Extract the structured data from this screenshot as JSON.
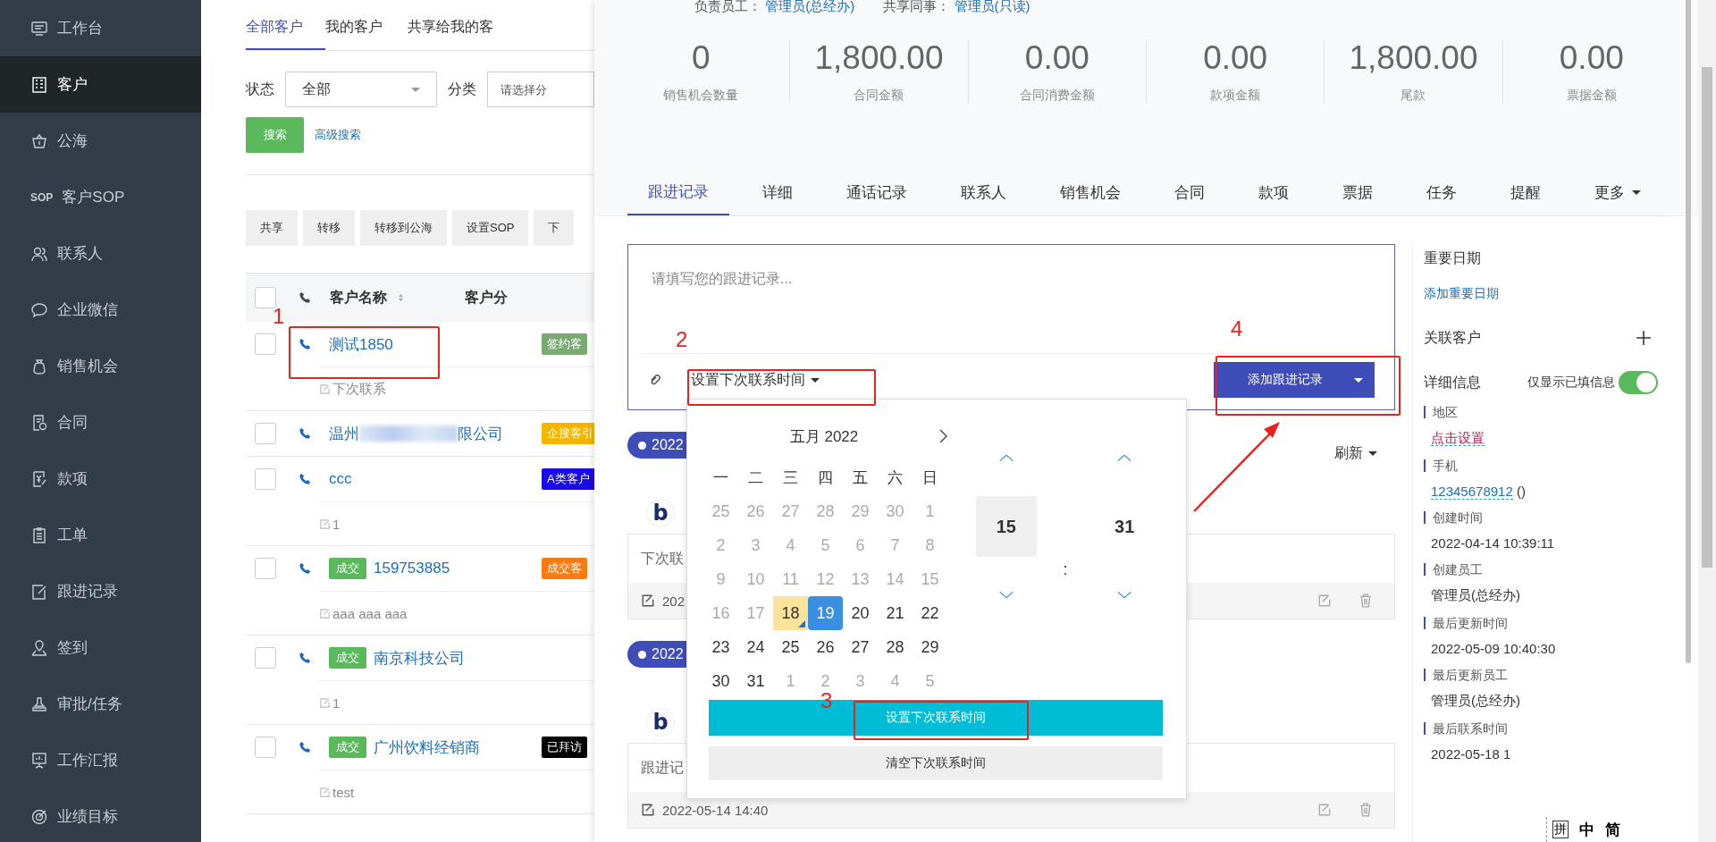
{
  "sidebar": {
    "items": [
      {
        "label": "工作台",
        "selected": false
      },
      {
        "label": "客户",
        "selected": true
      },
      {
        "label": "公海",
        "selected": false
      },
      {
        "label": "客户SOP",
        "icon_text": "SOP",
        "selected": false
      },
      {
        "label": "联系人",
        "selected": false
      },
      {
        "label": "企业微信",
        "selected": false
      },
      {
        "label": "销售机会",
        "selected": false
      },
      {
        "label": "合同",
        "selected": false
      },
      {
        "label": "款项",
        "selected": false
      },
      {
        "label": "工单",
        "selected": false
      },
      {
        "label": "跟进记录",
        "selected": false
      },
      {
        "label": "签到",
        "selected": false
      },
      {
        "label": "审批/任务",
        "selected": false
      },
      {
        "label": "工作汇报",
        "selected": false
      },
      {
        "label": "业绩目标",
        "selected": false
      }
    ]
  },
  "customer_list": {
    "tabs": [
      {
        "label": "全部客户",
        "selected": true
      },
      {
        "label": "我的客户",
        "selected": false
      },
      {
        "label": "共享给我的客",
        "selected": false
      }
    ],
    "filters": {
      "status_label": "状态",
      "status_value": "全部",
      "category_label": "分类",
      "category_placeholder": "请选择分"
    },
    "search_button": "搜索",
    "advanced_search": "高级搜索",
    "actions": [
      "共享",
      "转移",
      "转移到公海",
      "设置SOP",
      "下"
    ],
    "columns": {
      "name": "客户名称",
      "category": "客户分"
    },
    "select_all_checked": false,
    "rows": [
      {
        "checked": false,
        "name": "测试1850",
        "tag": "签约客",
        "color": "#7aa974",
        "note": "下次联系"
      },
      {
        "checked": false,
        "name": "温州",
        "redacted": true,
        "name_tail": "限公司",
        "tag": "企搜客引",
        "color": "#f4b400"
      },
      {
        "checked": false,
        "name": "ccc",
        "tag": "A类客户",
        "color": "#1a0ae6",
        "note": "1"
      },
      {
        "checked": false,
        "badge": "成交",
        "name": "159753885",
        "tag": "成交客",
        "color": "#ff7b0f",
        "note": "aaa aaa aaa"
      },
      {
        "checked": false,
        "badge": "成交",
        "name": "南京科技公司",
        "note": "1"
      },
      {
        "checked": false,
        "badge": "成交",
        "name": "广州饮料经销商",
        "tag": "已拜访",
        "color": "#000000",
        "note": "test"
      }
    ]
  },
  "detail": {
    "owner_line": {
      "owner_label": "负责员工：",
      "owner": "管理员(总经办)",
      "shared_label": "共享同事：",
      "shared": "管理员(只读)"
    },
    "stats": [
      {
        "value": "0",
        "label": "销售机会数量"
      },
      {
        "value": "1,800.00",
        "label": "合同金额"
      },
      {
        "value": "0.00",
        "label": "合同消费金额"
      },
      {
        "value": "0.00",
        "label": "款项金额"
      },
      {
        "value": "1,800.00",
        "label": "尾款"
      },
      {
        "value": "0.00",
        "label": "票据金额"
      }
    ],
    "tabs": [
      {
        "label": "跟进记录",
        "selected": true
      },
      {
        "label": "详细",
        "selected": false
      },
      {
        "label": "通话记录",
        "selected": false
      },
      {
        "label": "联系人",
        "selected": false
      },
      {
        "label": "销售机会",
        "selected": false
      },
      {
        "label": "合同",
        "selected": false
      },
      {
        "label": "款项",
        "selected": false
      },
      {
        "label": "票据",
        "selected": false
      },
      {
        "label": "任务",
        "selected": false
      },
      {
        "label": "提醒",
        "selected": false
      },
      {
        "label": "更多",
        "dropdown": true,
        "selected": false
      }
    ],
    "editor": {
      "placeholder": "请填写您的跟进记录...",
      "next_contact_button": "设置下次联系时间",
      "add_button": "添加跟进记录"
    },
    "refresh": "刷新",
    "timeline": [
      {
        "date": "2022",
        "logo": "b",
        "text": "下次联",
        "footer": "202"
      },
      {
        "date": "2022",
        "logo": "b",
        "text": "跟进记",
        "footer": "2022-05-14 14:40"
      }
    ],
    "datepicker": {
      "month": "五月 2022",
      "weekdays": [
        "一",
        "二",
        "三",
        "四",
        "五",
        "六",
        "日"
      ],
      "weeks": [
        [
          {
            "day": "25",
            "muted": true,
            "selected": false,
            "today": false
          },
          {
            "day": "26",
            "muted": true,
            "selected": false,
            "today": false
          },
          {
            "day": "27",
            "muted": true,
            "selected": false,
            "today": false
          },
          {
            "day": "28",
            "muted": true,
            "selected": false,
            "today": false
          },
          {
            "day": "29",
            "muted": true,
            "selected": false,
            "today": false
          },
          {
            "day": "30",
            "muted": true,
            "selected": false,
            "today": false
          },
          {
            "day": "1",
            "muted": true,
            "selected": false,
            "today": false
          }
        ],
        [
          {
            "day": "2",
            "muted": true,
            "selected": false,
            "today": false
          },
          {
            "day": "3",
            "muted": true,
            "selected": false,
            "today": false
          },
          {
            "day": "4",
            "muted": true,
            "selected": false,
            "today": false
          },
          {
            "day": "5",
            "muted": true,
            "selected": false,
            "today": false
          },
          {
            "day": "6",
            "muted": true,
            "selected": false,
            "today": false
          },
          {
            "day": "7",
            "muted": true,
            "selected": false,
            "today": false
          },
          {
            "day": "8",
            "muted": true,
            "selected": false,
            "today": false
          }
        ],
        [
          {
            "day": "9",
            "muted": true,
            "selected": false,
            "today": false
          },
          {
            "day": "10",
            "muted": true,
            "selected": false,
            "today": false
          },
          {
            "day": "11",
            "muted": true,
            "selected": false,
            "today": false
          },
          {
            "day": "12",
            "muted": true,
            "selected": false,
            "today": false
          },
          {
            "day": "13",
            "muted": true,
            "selected": false,
            "today": false
          },
          {
            "day": "14",
            "muted": true,
            "selected": false,
            "today": false
          },
          {
            "day": "15",
            "muted": true,
            "selected": false,
            "today": false
          }
        ],
        [
          {
            "day": "16",
            "muted": true,
            "selected": false,
            "today": false
          },
          {
            "day": "17",
            "muted": true,
            "selected": false,
            "today": false
          },
          {
            "day": "18",
            "muted": false,
            "selected": false,
            "today": true
          },
          {
            "day": "19",
            "muted": false,
            "selected": true,
            "today": false
          },
          {
            "day": "20",
            "muted": false,
            "selected": false,
            "today": false
          },
          {
            "day": "21",
            "muted": false,
            "selected": false,
            "today": false
          },
          {
            "day": "22",
            "muted": false,
            "selected": false,
            "today": false
          }
        ],
        [
          {
            "day": "23",
            "muted": false,
            "selected": false,
            "today": false
          },
          {
            "day": "24",
            "muted": false,
            "selected": false,
            "today": false
          },
          {
            "day": "25",
            "muted": false,
            "selected": false,
            "today": false
          },
          {
            "day": "26",
            "muted": false,
            "selected": false,
            "today": false
          },
          {
            "day": "27",
            "muted": false,
            "selected": false,
            "today": false
          },
          {
            "day": "28",
            "muted": false,
            "selected": false,
            "today": false
          },
          {
            "day": "29",
            "muted": false,
            "selected": false,
            "today": false
          }
        ],
        [
          {
            "day": "30",
            "muted": false,
            "selected": false,
            "today": false
          },
          {
            "day": "31",
            "muted": false,
            "selected": false,
            "today": false
          },
          {
            "day": "1",
            "muted": true,
            "selected": false,
            "today": false
          },
          {
            "day": "2",
            "muted": true,
            "selected": false,
            "today": false
          },
          {
            "day": "3",
            "muted": true,
            "selected": false,
            "today": false
          },
          {
            "day": "4",
            "muted": true,
            "selected": false,
            "today": false
          },
          {
            "day": "5",
            "muted": true,
            "selected": false,
            "today": false
          }
        ]
      ],
      "hour": "15",
      "separator": ":",
      "minute": "31",
      "set_button": "设置下次联系时间",
      "clear_button": "清空下次联系时间"
    },
    "side": {
      "important_dates": "重要日期",
      "add_date": "添加重要日期",
      "related": "关联客户",
      "details": "详细信息",
      "filled_only": "仅显示已填信息",
      "filled_only_on": true,
      "fields": [
        {
          "label": "地区",
          "kind": "action",
          "value": "点击设置"
        },
        {
          "label": "手机",
          "kind": "phone",
          "value": "12345678912",
          "suffix": "()"
        },
        {
          "label": "创建时间",
          "kind": "text",
          "value": "2022-04-14 10:39:11"
        },
        {
          "label": "创建员工",
          "kind": "text",
          "value": "管理员(总经办)"
        },
        {
          "label": "最后更新时间",
          "kind": "text",
          "value": "2022-05-09 10:40:30"
        },
        {
          "label": "最后更新员工",
          "kind": "text",
          "value": "管理员(总经办)"
        },
        {
          "label": "最后联系时间",
          "kind": "text",
          "value": "2022-05-18 1"
        }
      ]
    }
  },
  "annotations": [
    {
      "label": "1"
    },
    {
      "label": "2"
    },
    {
      "label": "3"
    },
    {
      "label": "4"
    }
  ],
  "ime_bar": [
    "拼",
    "中",
    "简"
  ]
}
